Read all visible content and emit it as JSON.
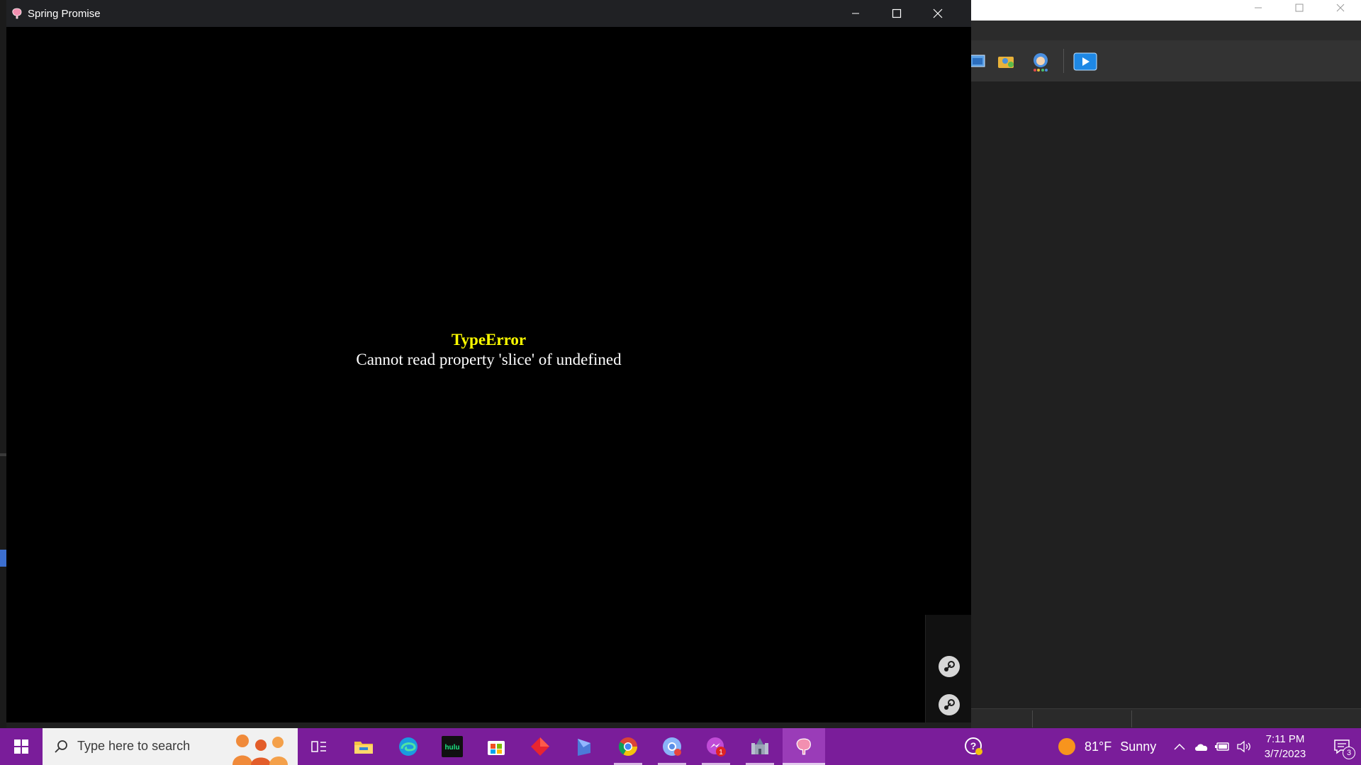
{
  "window": {
    "title": "Spring Promise",
    "controls": [
      "minimize",
      "maximize",
      "close"
    ]
  },
  "error": {
    "type": "TypeError",
    "message": "Cannot read property 'slice' of undefined"
  },
  "overlay": {
    "steam_icons": [
      "steam-icon",
      "steam-icon"
    ]
  },
  "background_app": {
    "toolbar_icons": [
      "image-icon",
      "folder-people-icon",
      "character-icon",
      "play-video-icon"
    ]
  },
  "taskbar": {
    "search_placeholder": "Type here to search",
    "apps": [
      "task-view-icon",
      "file-explorer-icon",
      "edge-icon",
      "hulu-icon",
      "store-icon",
      "red-diamond-icon",
      "app-logo-icon",
      "chrome-icon",
      "chrome-alt-icon",
      "messenger-icon",
      "castle-icon",
      "spring-promise-icon"
    ],
    "messenger_badge": "1",
    "weather": {
      "temp": "81°F",
      "condition": "Sunny"
    },
    "clock": {
      "time": "7:11 PM",
      "date": "3/7/2023"
    },
    "notification_count": "3"
  },
  "colors": {
    "taskbar": "#7a1d9a",
    "error_title": "#ffff00",
    "error_message": "#ffffff",
    "titlebar": "#202124"
  }
}
